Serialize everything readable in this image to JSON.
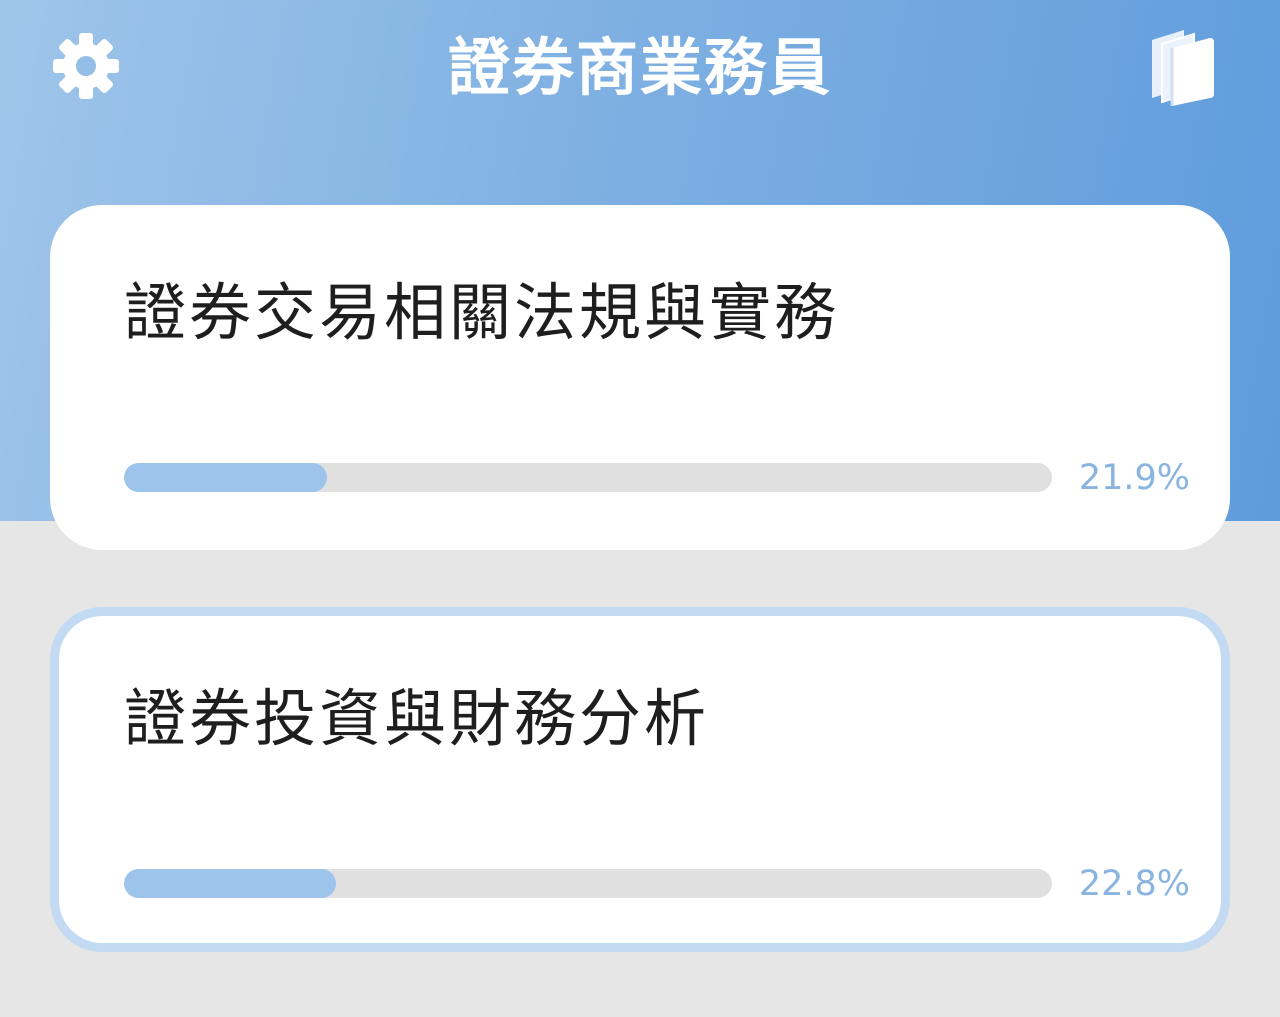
{
  "header": {
    "title": "證券商業務員",
    "settings_icon": "gear-icon",
    "library_icon": "books-icon",
    "gradient_colors": [
      "#9fc5ea",
      "#5f9cdc"
    ]
  },
  "subjects": [
    {
      "title": "證券交易相關法規與實務",
      "progress": 0.219,
      "progress_label": "21.9%"
    },
    {
      "title": "證券投資與財務分析",
      "progress": 0.228,
      "progress_label": "22.8%",
      "selected": true
    }
  ],
  "colors": {
    "background": "#e6e6e6",
    "card": "#ffffff",
    "progress_fill": "#9dc4ea",
    "progress_track": "#e0e0e0",
    "percent_text": "#8ab4e0",
    "selected_border": "#c2dbf3"
  }
}
